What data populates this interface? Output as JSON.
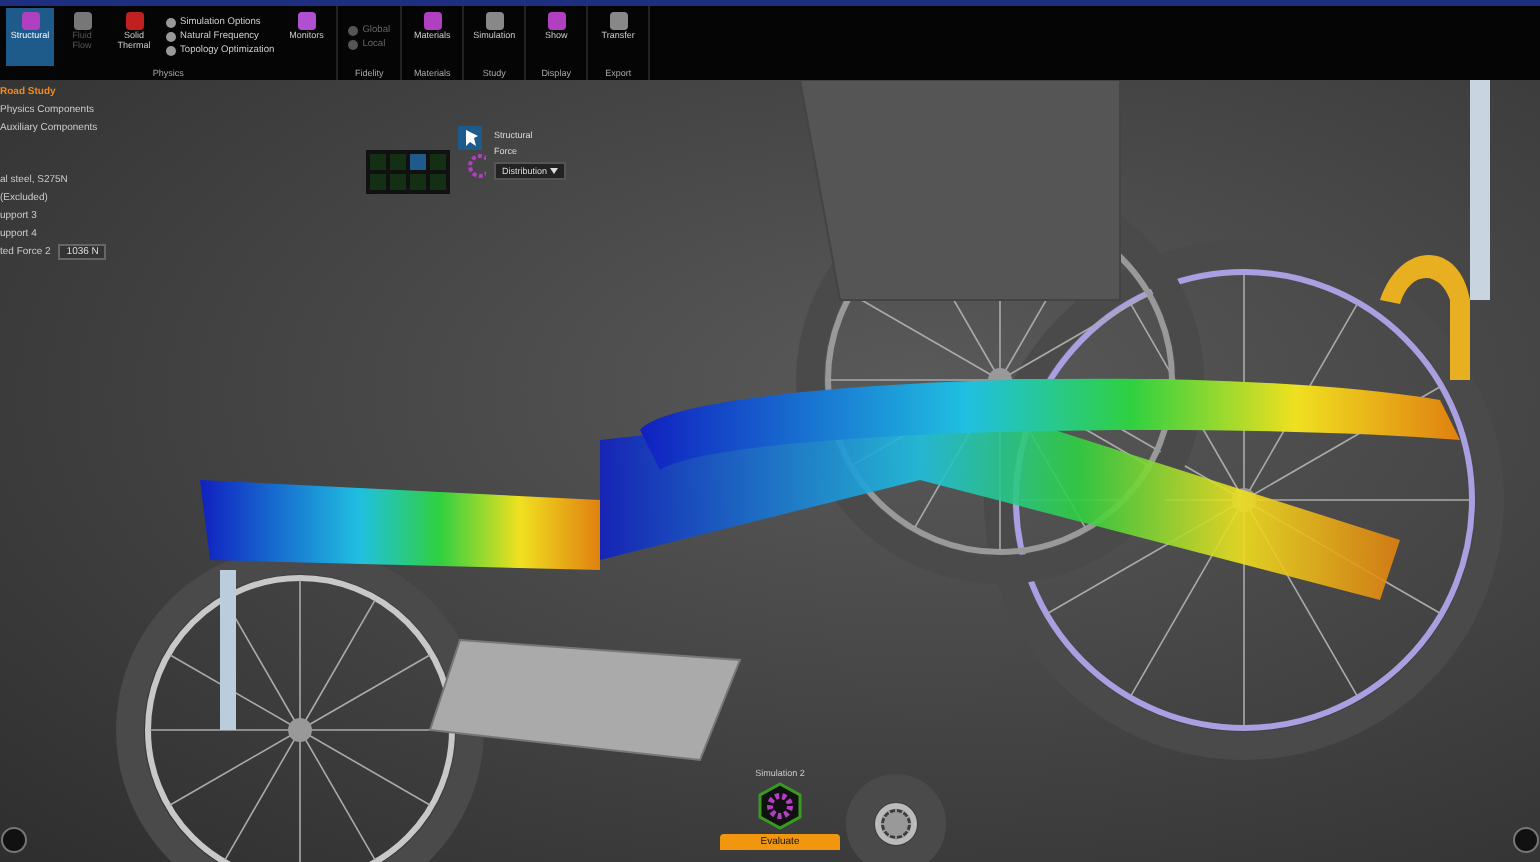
{
  "ribbon": {
    "groups": [
      {
        "label": "Physics",
        "items": [
          {
            "kind": "large",
            "label": "Structural",
            "selected": true,
            "disabled": false
          },
          {
            "kind": "large",
            "label": "Fluid Flow",
            "selected": false,
            "disabled": true
          },
          {
            "kind": "large",
            "label": "Solid Thermal",
            "selected": false,
            "disabled": false
          },
          {
            "kind": "list",
            "entries": [
              "Simulation Options",
              "Natural Frequency",
              "Topology Optimization"
            ]
          },
          {
            "kind": "large",
            "label": "Monitors",
            "selected": false,
            "disabled": false
          }
        ]
      },
      {
        "label": "Fidelity",
        "items": [
          {
            "kind": "list-disabled",
            "entries": [
              "Global",
              "Local"
            ]
          }
        ]
      },
      {
        "label": "Materials",
        "items": [
          {
            "kind": "large",
            "label": "Materials",
            "selected": false,
            "disabled": false
          }
        ]
      },
      {
        "label": "Study",
        "items": [
          {
            "kind": "large",
            "label": "Simulation",
            "selected": false,
            "disabled": false
          }
        ]
      },
      {
        "label": "Display",
        "items": [
          {
            "kind": "large",
            "label": "Show",
            "selected": false,
            "disabled": false
          }
        ]
      },
      {
        "label": "Export",
        "items": [
          {
            "kind": "large",
            "label": "Transfer",
            "selected": false,
            "disabled": false
          }
        ]
      }
    ]
  },
  "tree": [
    {
      "kind": "header",
      "label": "Road Study"
    },
    {
      "kind": "item",
      "label": "Physics Components"
    },
    {
      "kind": "item",
      "label": "Auxiliary Components"
    },
    {
      "kind": "gap"
    },
    {
      "kind": "item",
      "label": "al steel, S275N"
    },
    {
      "kind": "item",
      "label": "(Excluded)"
    },
    {
      "kind": "item",
      "label": "upport 3"
    },
    {
      "kind": "item",
      "label": "upport 4"
    },
    {
      "kind": "value",
      "label": "ted Force 2",
      "value": "1036 N"
    }
  ],
  "tool_popup": {
    "title": "Structural",
    "subtitle": "Force",
    "dropdown": "Distribution"
  },
  "hub": {
    "study": "Simulation 2",
    "action": "Evaluate"
  }
}
